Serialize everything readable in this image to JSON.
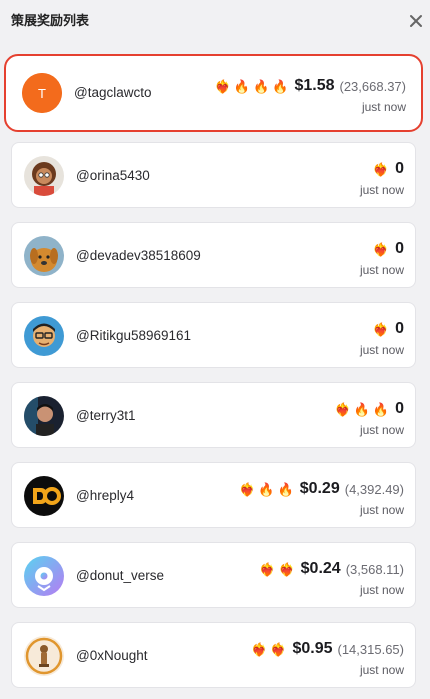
{
  "header": {
    "title": "策展奖励列表",
    "close_icon": "close-icon"
  },
  "items": [
    {
      "handle": "@tagclawcto",
      "avatar_initial": "T",
      "avatar_color": "#f36b1c",
      "emojis": [
        "❤️‍🔥",
        "🔥",
        "🔥",
        "🔥"
      ],
      "amount": "$1.58",
      "sub": "(23,668.37)",
      "time": "just now",
      "highlighted": true
    },
    {
      "handle": "@orina5430",
      "emojis": [
        "❤️‍🔥"
      ],
      "amount": "0",
      "sub": "",
      "time": "just now"
    },
    {
      "handle": "@devadev38518609",
      "emojis": [
        "❤️‍🔥"
      ],
      "amount": "0",
      "sub": "",
      "time": "just now"
    },
    {
      "handle": "@Ritikgu58969161",
      "emojis": [
        "❤️‍🔥"
      ],
      "amount": "0",
      "sub": "",
      "time": "just now"
    },
    {
      "handle": "@terry3t1",
      "emojis": [
        "❤️‍🔥",
        "🔥",
        "🔥"
      ],
      "amount": "0",
      "sub": "",
      "time": "just now"
    },
    {
      "handle": "@hreply4",
      "emojis": [
        "❤️‍🔥",
        "🔥",
        "🔥"
      ],
      "amount": "$0.29",
      "sub": "(4,392.49)",
      "time": "just now"
    },
    {
      "handle": "@donut_verse",
      "emojis": [
        "❤️‍🔥",
        "❤️‍🔥"
      ],
      "amount": "$0.24",
      "sub": "(3,568.11)",
      "time": "just now"
    },
    {
      "handle": "@0xNought",
      "emojis": [
        "❤️‍🔥",
        "❤️‍🔥"
      ],
      "amount": "$0.95",
      "sub": "(14,315.65)",
      "time": "just now"
    }
  ],
  "colors": {
    "highlight_border": "#e5402f",
    "accent_orange": "#f36b1c"
  }
}
